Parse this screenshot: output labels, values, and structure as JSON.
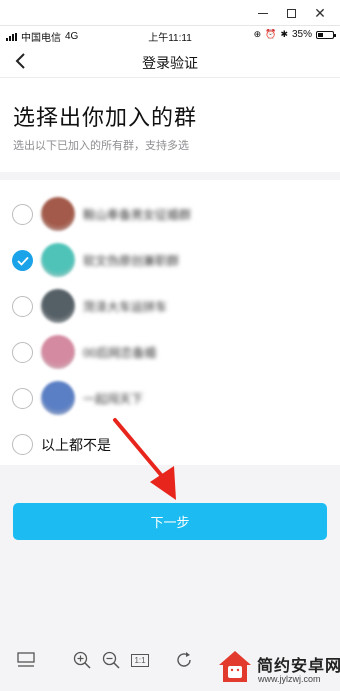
{
  "status_bar": {
    "carrier": "中国电信",
    "network": "4G",
    "time": "上午11:11",
    "battery": "35%",
    "battery_level": 0.35
  },
  "nav": {
    "title": "登录验证"
  },
  "header": {
    "heading": "选择出你加入的群",
    "subheading": "选出以下已加入的所有群，支持多选"
  },
  "groups": [
    {
      "name": "鞍山奉备男女征婚群",
      "checked": false,
      "avatar_color": "#a35a4a"
    },
    {
      "name": "软文伪原创兼职群",
      "checked": true,
      "avatar_color": "#4fc3b8"
    },
    {
      "name": "菏泽大车运拼车",
      "checked": false,
      "avatar_color": "#556066"
    },
    {
      "name": "00后网恋备婚",
      "checked": false,
      "avatar_color": "#d48aa0"
    },
    {
      "name": "一起闯天下",
      "checked": false,
      "avatar_color": "#5b7fc4"
    }
  ],
  "none_option": {
    "label": "以上都不是",
    "checked": false
  },
  "next_button": {
    "label": "下一步"
  },
  "toolbar": {
    "actual_size_label": "1:1"
  },
  "watermark": {
    "title": "简约安卓网",
    "subtitle": "www.jylzwj.com"
  },
  "colors": {
    "accent": "#1cbcf2",
    "checked": "#1aa3e8",
    "arrow": "#e8251c"
  }
}
